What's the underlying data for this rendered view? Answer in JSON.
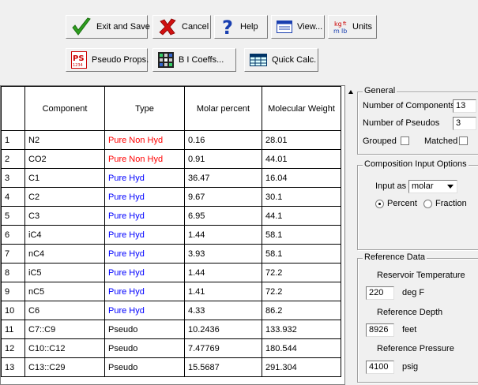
{
  "toolbar": {
    "exit_save": "Exit and Save",
    "cancel": "Cancel",
    "help": "Help",
    "view": "View...",
    "units": "Units",
    "units_icon_text": "kg/ft m/lb",
    "pseudo_props": "Pseudo Props.",
    "pseudo_icon_text": "PS",
    "bi_coeffs": "B I Coeffs...",
    "quick_calc": "Quick Calc."
  },
  "table": {
    "headers": [
      "Component",
      "Type",
      "Molar percent",
      "Molecular Weight"
    ],
    "rows": [
      {
        "n": "1",
        "component": "N2",
        "type": "Pure Non Hyd",
        "molar": "0.16",
        "mw": "28.01",
        "color": "#ff0000"
      },
      {
        "n": "2",
        "component": "CO2",
        "type": "Pure Non Hyd",
        "molar": "0.91",
        "mw": "44.01",
        "color": "#ff0000"
      },
      {
        "n": "3",
        "component": "C1",
        "type": "Pure Hyd",
        "molar": "36.47",
        "mw": "16.04",
        "color": "#0000ff"
      },
      {
        "n": "4",
        "component": "C2",
        "type": "Pure Hyd",
        "molar": "9.67",
        "mw": "30.1",
        "color": "#0000ff"
      },
      {
        "n": "5",
        "component": "C3",
        "type": "Pure Hyd",
        "molar": "6.95",
        "mw": "44.1",
        "color": "#0000ff"
      },
      {
        "n": "6",
        "component": "iC4",
        "type": "Pure Hyd",
        "molar": "1.44",
        "mw": "58.1",
        "color": "#0000ff"
      },
      {
        "n": "7",
        "component": "nC4",
        "type": "Pure Hyd",
        "molar": "3.93",
        "mw": "58.1",
        "color": "#0000ff"
      },
      {
        "n": "8",
        "component": "iC5",
        "type": "Pure Hyd",
        "molar": "1.44",
        "mw": "72.2",
        "color": "#0000ff"
      },
      {
        "n": "9",
        "component": "nC5",
        "type": "Pure Hyd",
        "molar": "1.41",
        "mw": "72.2",
        "color": "#0000ff"
      },
      {
        "n": "10",
        "component": "C6",
        "type": "Pure Hyd",
        "molar": "4.33",
        "mw": "86.2",
        "color": "#0000ff"
      },
      {
        "n": "11",
        "component": "C7::C9",
        "type": "Pseudo",
        "molar": "10.2436",
        "mw": "133.932",
        "color": "#000000"
      },
      {
        "n": "12",
        "component": "C10::C12",
        "type": "Pseudo",
        "molar": "7.47769",
        "mw": "180.544",
        "color": "#000000"
      },
      {
        "n": "13",
        "component": "C13::C29",
        "type": "Pseudo",
        "molar": "15.5687",
        "mw": "291.304",
        "color": "#000000"
      }
    ]
  },
  "general": {
    "title": "General",
    "num_components_label": "Number of Components",
    "num_components": "13",
    "num_pseudos_label": "Number of Pseudos",
    "num_pseudos": "3",
    "grouped_label": "Grouped",
    "matched_label": "Matched"
  },
  "composition": {
    "title": "Composition Input Options",
    "input_as_label": "Input as",
    "input_as_value": "molar",
    "percent_label": "Percent",
    "fraction_label": "Fraction"
  },
  "reference": {
    "title": "Reference Data",
    "temp_label": "Reservoir Temperature",
    "temp_value": "220",
    "temp_unit": "deg F",
    "depth_label": "Reference Depth",
    "depth_value": "8926",
    "depth_unit": "feet",
    "pressure_label": "Reference Pressure",
    "pressure_value": "4100",
    "pressure_unit": "psig"
  }
}
